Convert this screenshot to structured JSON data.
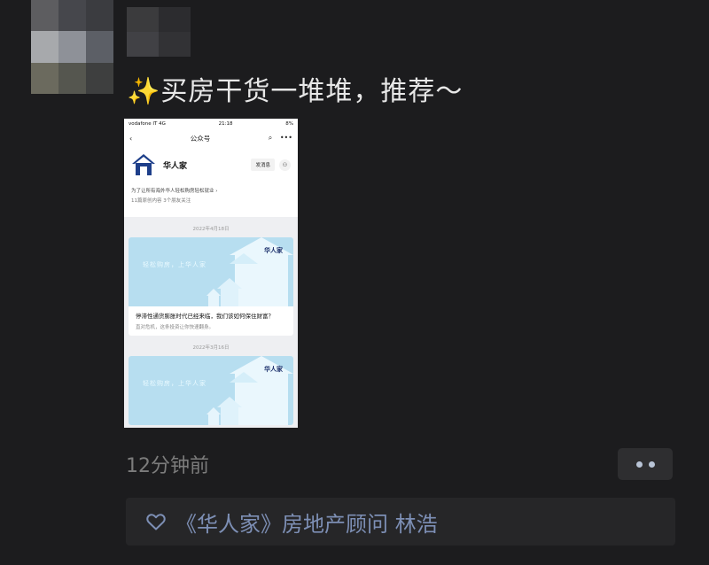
{
  "post": {
    "sparkle": "✨",
    "text": "买房干货一堆堆，推荐～",
    "time": "12分钟前"
  },
  "avatar_colors": [
    "#5d5d60",
    "#46474c",
    "#3b3c40",
    "#a7a9ac",
    "#8e9198",
    "#5c5f66",
    "#6b6a5e",
    "#55564f",
    "#3e3f3f"
  ],
  "name_colors": [
    "#3b3b3d",
    "#2c2c2f",
    "#414145",
    "#323235"
  ],
  "screenshot": {
    "status": {
      "carrier": "vodafone IT 4G",
      "time": "21:18",
      "battery": "8%"
    },
    "nav": {
      "back": "‹",
      "title": "公众号",
      "search": "⌕",
      "more": "•••"
    },
    "account": {
      "name": "华人家",
      "send_label": "发消息",
      "user_icon": "⚇",
      "description": "为了让所有海外华人轻松购房轻松就业 ›",
      "meta": "11篇原创内容   3个朋友关注"
    },
    "articles": [
      {
        "date": "2022年4月18日",
        "slogan": "轻松购房，上华人家",
        "brand": "华人家",
        "title": "停滞性通货膨胀时代已经来临，我们该如何保住财富？",
        "subtitle": "直对危机，这条投资让你快速翻身。"
      },
      {
        "date": "2022年3月16日",
        "slogan": "轻松购房，上华人家",
        "brand": "华人家"
      }
    ]
  },
  "likes": {
    "heart_icon": "heart-outline-icon",
    "names": "《华人家》房地产顾问 林浩"
  }
}
